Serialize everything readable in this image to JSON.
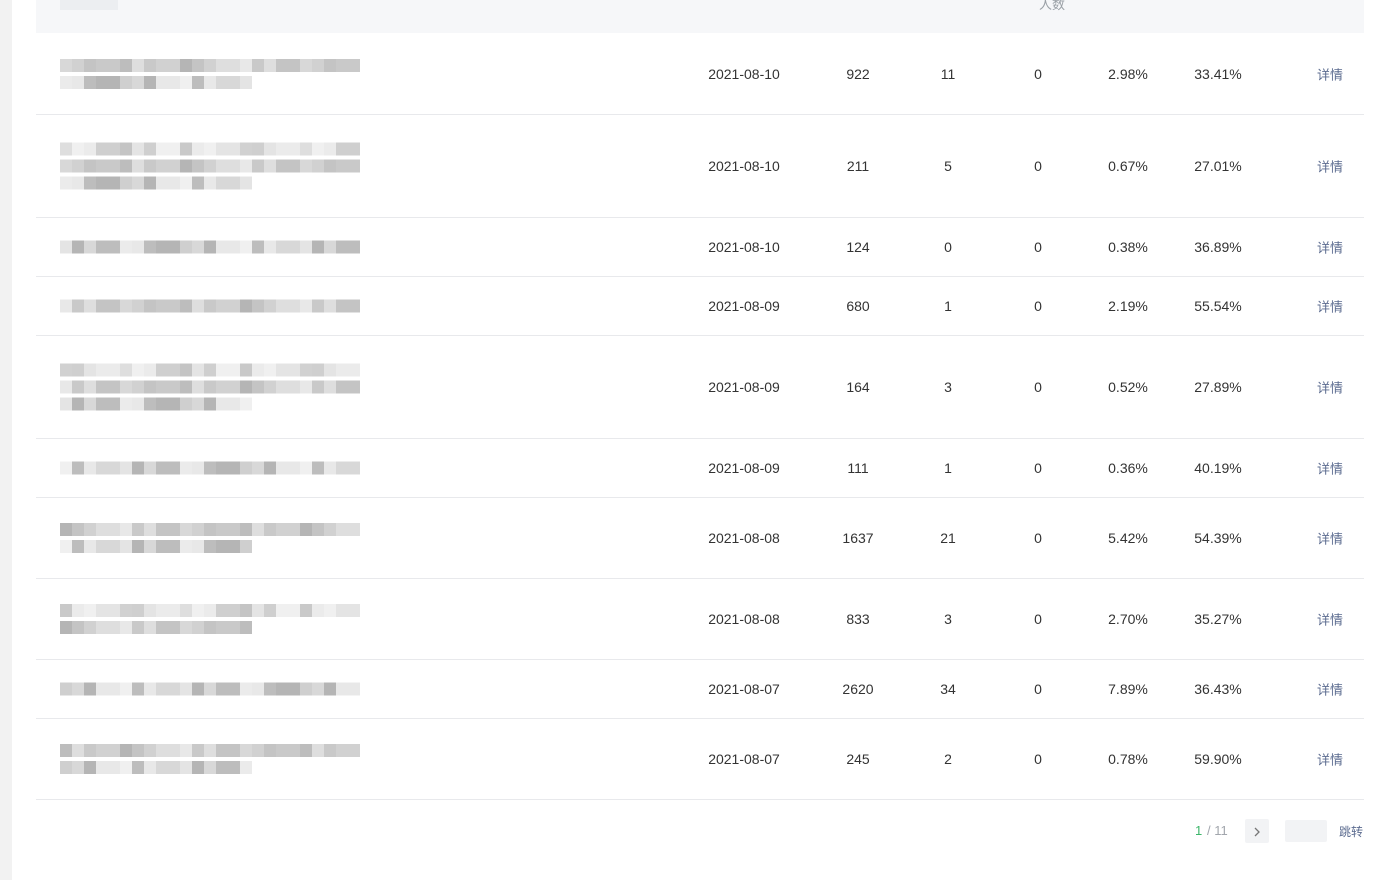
{
  "table": {
    "header": {
      "visible_partial_label": "人数"
    },
    "rows": [
      {
        "date": "2021-08-10",
        "v1": "922",
        "v2": "11",
        "v3": "0",
        "pct1": "2.98%",
        "pct2": "33.41%",
        "action": "详情"
      },
      {
        "date": "2021-08-10",
        "v1": "211",
        "v2": "5",
        "v3": "0",
        "pct1": "0.67%",
        "pct2": "27.01%",
        "action": "详情"
      },
      {
        "date": "2021-08-10",
        "v1": "124",
        "v2": "0",
        "v3": "0",
        "pct1": "0.38%",
        "pct2": "36.89%",
        "action": "详情"
      },
      {
        "date": "2021-08-09",
        "v1": "680",
        "v2": "1",
        "v3": "0",
        "pct1": "2.19%",
        "pct2": "55.54%",
        "action": "详情"
      },
      {
        "date": "2021-08-09",
        "v1": "164",
        "v2": "3",
        "v3": "0",
        "pct1": "0.52%",
        "pct2": "27.89%",
        "action": "详情"
      },
      {
        "date": "2021-08-09",
        "v1": "111",
        "v2": "1",
        "v3": "0",
        "pct1": "0.36%",
        "pct2": "40.19%",
        "action": "详情"
      },
      {
        "date": "2021-08-08",
        "v1": "1637",
        "v2": "21",
        "v3": "0",
        "pct1": "5.42%",
        "pct2": "54.39%",
        "action": "详情"
      },
      {
        "date": "2021-08-08",
        "v1": "833",
        "v2": "3",
        "v3": "0",
        "pct1": "2.70%",
        "pct2": "35.27%",
        "action": "详情"
      },
      {
        "date": "2021-08-07",
        "v1": "2620",
        "v2": "34",
        "v3": "0",
        "pct1": "7.89%",
        "pct2": "36.43%",
        "action": "详情"
      },
      {
        "date": "2021-08-07",
        "v1": "245",
        "v2": "2",
        "v3": "0",
        "pct1": "0.78%",
        "pct2": "59.90%",
        "action": "详情"
      }
    ]
  },
  "pagination": {
    "current_page": "1",
    "total_pages": "/ 11",
    "next_icon": "chevron-right-icon",
    "jump_label": "跳转",
    "accent_color": "#3cb66a"
  }
}
